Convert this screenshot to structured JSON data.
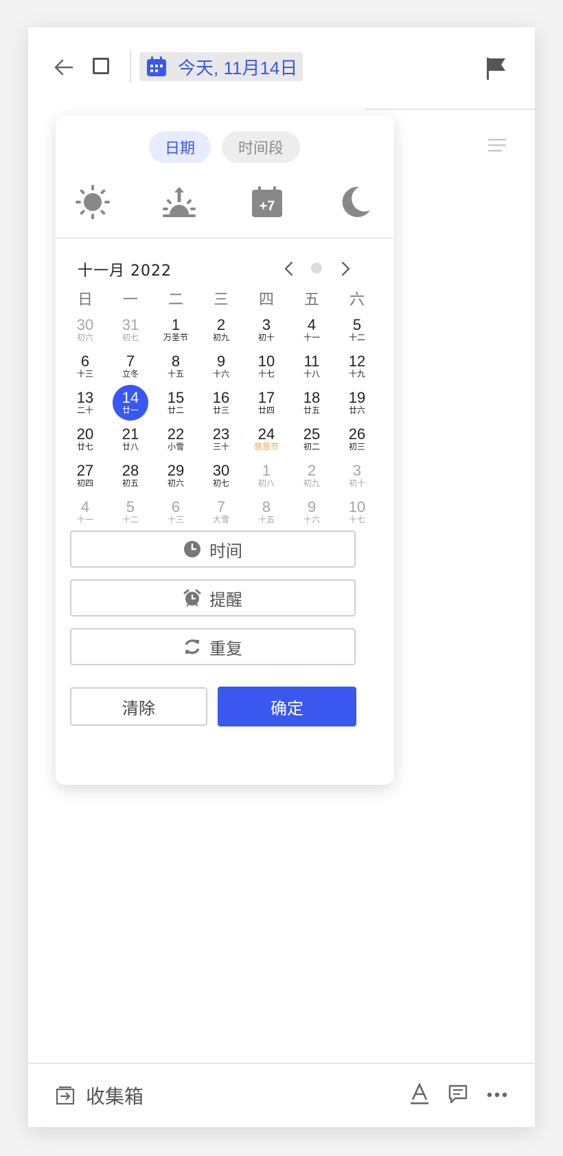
{
  "header": {
    "date_chip_label": "今天, 11月14日"
  },
  "picker": {
    "segments": [
      "日期",
      "时间段"
    ],
    "quick_actions": [
      "sun-icon",
      "sunrise-icon",
      "calendar-plus7-icon",
      "moon-icon"
    ],
    "quick_plus7_label": "+7",
    "month_title": "十一月   2022",
    "weekdays": [
      "日",
      "一",
      "二",
      "三",
      "四",
      "五",
      "六"
    ],
    "weeks": [
      [
        [
          "30",
          "初六"
        ],
        [
          "31",
          "初七"
        ],
        [
          "1",
          "万圣节"
        ],
        [
          "2",
          "初九"
        ],
        [
          "3",
          "初十"
        ],
        [
          "4",
          "十一"
        ],
        [
          "5",
          "十二"
        ]
      ],
      [
        [
          "6",
          "十三"
        ],
        [
          "7",
          "立冬"
        ],
        [
          "8",
          "十五"
        ],
        [
          "9",
          "十六"
        ],
        [
          "10",
          "十七"
        ],
        [
          "11",
          "十八"
        ],
        [
          "12",
          "十九"
        ]
      ],
      [
        [
          "13",
          "二十"
        ],
        [
          "14",
          "廿一"
        ],
        [
          "15",
          "廿二"
        ],
        [
          "16",
          "廿三"
        ],
        [
          "17",
          "廿四"
        ],
        [
          "18",
          "廿五"
        ],
        [
          "19",
          "廿六"
        ]
      ],
      [
        [
          "20",
          "廿七"
        ],
        [
          "21",
          "廿八"
        ],
        [
          "22",
          "小雪"
        ],
        [
          "23",
          "三十"
        ],
        [
          "24",
          "感恩节"
        ],
        [
          "25",
          "初二"
        ],
        [
          "26",
          "初三"
        ]
      ],
      [
        [
          "27",
          "初四"
        ],
        [
          "28",
          "初五"
        ],
        [
          "29",
          "初六"
        ],
        [
          "30",
          "初七"
        ],
        [
          "1",
          "初八"
        ],
        [
          "2",
          "初九"
        ],
        [
          "3",
          "初十"
        ]
      ],
      [
        [
          "4",
          "十一"
        ],
        [
          "5",
          "十二"
        ],
        [
          "6",
          "十三"
        ],
        [
          "7",
          "大雪"
        ],
        [
          "8",
          "十五"
        ],
        [
          "9",
          "十六"
        ],
        [
          "10",
          "十七"
        ]
      ]
    ],
    "selected_day": "14",
    "options": {
      "time": "时间",
      "reminder": "提醒",
      "repeat": "重复"
    },
    "clear_label": "清除",
    "confirm_label": "确定"
  },
  "footer": {
    "inbox_label": "收集箱"
  },
  "colors": {
    "accent": "#3a57f0",
    "holiday": "#f5a040",
    "muted": "#a5a5a5"
  }
}
